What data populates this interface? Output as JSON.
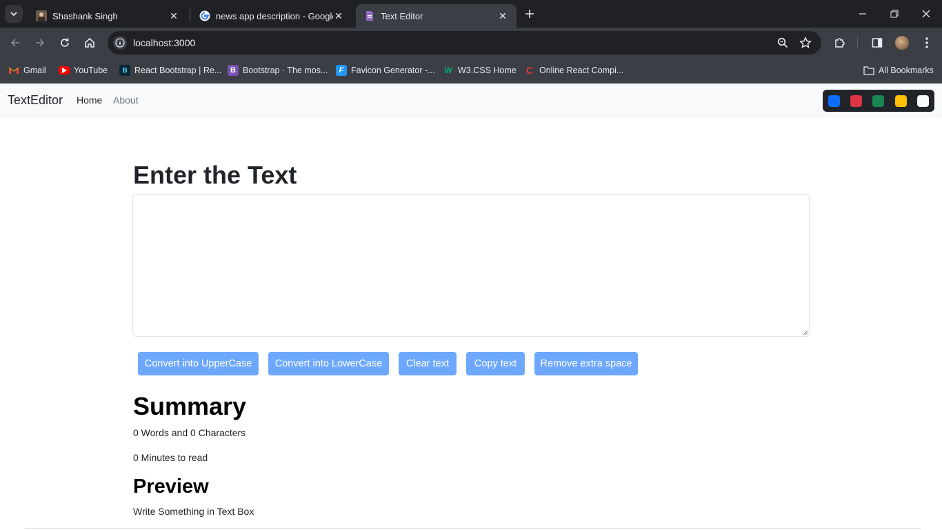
{
  "browser": {
    "tabs": [
      {
        "title": "Shashank Singh",
        "favicon": "profile-photo-icon",
        "active": false
      },
      {
        "title": "news app description - Google",
        "favicon": "google-icon",
        "active": false
      },
      {
        "title": "Text Editor",
        "favicon": "document-icon",
        "active": true
      }
    ],
    "url": "localhost:3000",
    "bookmarks": [
      {
        "label": "Gmail",
        "icon": "gmail-icon",
        "color": "#ea4335"
      },
      {
        "label": "YouTube",
        "icon": "youtube-icon",
        "color": "#ff0000"
      },
      {
        "label": "React Bootstrap | Re...",
        "icon": "react-bootstrap-icon",
        "color": "#41e0fd"
      },
      {
        "label": "Bootstrap · The mos...",
        "icon": "bootstrap-icon",
        "color": "#7952b3"
      },
      {
        "label": "Favicon Generator -...",
        "icon": "favicon-generator-icon",
        "color": "#2196f3"
      },
      {
        "label": "W3.CSS Home",
        "icon": "w3schools-icon",
        "color": "#04aa6d"
      },
      {
        "label": "Online React Compi...",
        "icon": "compiler-icon",
        "color": "#e53935"
      }
    ],
    "all_bookmarks": "All Bookmarks"
  },
  "navbar": {
    "brand": "TextEditor",
    "links": [
      "Home",
      "About"
    ],
    "theme_colors": [
      "#0d6efd",
      "#dc3545",
      "#198754",
      "#ffc107",
      "#f8f9fa"
    ]
  },
  "main": {
    "heading": "Enter the Text",
    "textarea_value": "",
    "buttons": [
      "Convert into UpperCase",
      "Convert into LowerCase",
      "Clear text",
      "Copy text",
      "Remove extra space"
    ],
    "summary_heading": "Summary",
    "word_count_text": "0 Words and 0 Characters",
    "read_time_text": "0 Minutes to read",
    "preview_heading": "Preview",
    "preview_text": "Write Something in Text Box"
  }
}
